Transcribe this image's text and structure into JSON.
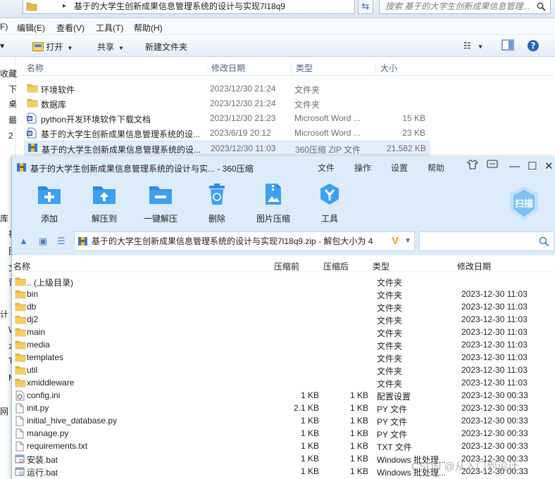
{
  "explorer": {
    "path": "基于的大学生创新成果信息管理系统的设计与实现7l18q9",
    "search_placeholder": "搜索 基于的大学生创新成果信息管理...",
    "menu": [
      "F)",
      "编辑(E)",
      "查看(V)",
      "工具(T)",
      "帮助(H)"
    ],
    "toolbar": {
      "open": "打开",
      "share": "共享",
      "new_folder": "新建文件夹"
    },
    "nav_fragments": [
      "收藏",
      "下",
      "桌",
      "最",
      "2",
      "库",
      "视",
      "图",
      "文",
      "音",
      "计",
      "W",
      "本",
      "T",
      "M",
      "网"
    ],
    "columns": {
      "name": "名称",
      "date": "修改日期",
      "type": "类型",
      "size": "大小"
    },
    "files": [
      {
        "name": "环境软件",
        "date": "2023/12/30 21:24",
        "type": "文件夹",
        "size": "",
        "icon": "folder"
      },
      {
        "name": "数据库",
        "date": "2023/12/30 21:24",
        "type": "文件夹",
        "size": "",
        "icon": "folder"
      },
      {
        "name": "python开发环境软件下载文档",
        "date": "2023/12/30 21:23",
        "type": "Microsoft Word ...",
        "size": "15 KB",
        "icon": "word"
      },
      {
        "name": "基于的大学生创新成果信息管理系统的设...",
        "date": "2023/6/19 20:12",
        "type": "Microsoft Word ...",
        "size": "23 KB",
        "icon": "word"
      },
      {
        "name": "基于的大学生创新成果信息管理系统的设...",
        "date": "2023/12/30 11:03",
        "type": "360压缩 ZIP 文件",
        "size": "21,582 KB",
        "icon": "zip",
        "selected": true
      }
    ]
  },
  "zip": {
    "title": "基于的大学生创新成果信息管理系统的设计与实... - 360压缩",
    "menu": {
      "file": "文件",
      "ops": "操作",
      "settings": "设置",
      "help": "帮助"
    },
    "tools": {
      "add": "添加",
      "extract": "解压到",
      "one_click": "一键解压",
      "delete": "删除",
      "image": "图片压缩",
      "tools": "工具"
    },
    "scan": "扫描",
    "path": "基于的大学生创新成果信息管理系统的设计与实现7l18q9.zip - 解包大小为 4",
    "columns": {
      "name": "名称",
      "before": "压缩前",
      "after": "压缩后",
      "type": "类型",
      "date": "修改日期"
    },
    "entries": [
      {
        "name": ".. (上级目录)",
        "before": "",
        "after": "",
        "type": "文件夹",
        "date": "",
        "icon": "folder"
      },
      {
        "name": "bin",
        "before": "",
        "after": "",
        "type": "文件夹",
        "date": "2023-12-30 11:03",
        "icon": "folder"
      },
      {
        "name": "db",
        "before": "",
        "after": "",
        "type": "文件夹",
        "date": "2023-12-30 11:03",
        "icon": "folder"
      },
      {
        "name": "dj2",
        "before": "",
        "after": "",
        "type": "文件夹",
        "date": "2023-12-30 11:03",
        "icon": "folder"
      },
      {
        "name": "main",
        "before": "",
        "after": "",
        "type": "文件夹",
        "date": "2023-12-30 11:03",
        "icon": "folder"
      },
      {
        "name": "media",
        "before": "",
        "after": "",
        "type": "文件夹",
        "date": "2023-12-30 11:03",
        "icon": "folder"
      },
      {
        "name": "templates",
        "before": "",
        "after": "",
        "type": "文件夹",
        "date": "2023-12-30 11:03",
        "icon": "folder"
      },
      {
        "name": "util",
        "before": "",
        "after": "",
        "type": "文件夹",
        "date": "2023-12-30 11:03",
        "icon": "folder"
      },
      {
        "name": "xmiddleware",
        "before": "",
        "after": "",
        "type": "文件夹",
        "date": "2023-12-30 11:03",
        "icon": "folder"
      },
      {
        "name": "config.ini",
        "before": "1 KB",
        "after": "1 KB",
        "type": "配置设置",
        "date": "2023-12-30 00:33",
        "icon": "ini"
      },
      {
        "name": "init.py",
        "before": "2.1 KB",
        "after": "1 KB",
        "type": "PY 文件",
        "date": "2023-12-30 00:33",
        "icon": "file"
      },
      {
        "name": "initial_hive_database.py",
        "before": "1 KB",
        "after": "1 KB",
        "type": "PY 文件",
        "date": "2023-12-30 00:33",
        "icon": "file"
      },
      {
        "name": "manage.py",
        "before": "1 KB",
        "after": "1 KB",
        "type": "PY 文件",
        "date": "2023-12-30 00:33",
        "icon": "file"
      },
      {
        "name": "requirements.txt",
        "before": "1 KB",
        "after": "1 KB",
        "type": "TXT 文件",
        "date": "2023-12-30 00:33",
        "icon": "file"
      },
      {
        "name": "安装.bat",
        "before": "1 KB",
        "after": "1 KB",
        "type": "Windows 批处理...",
        "date": "2023-12-30 00:33",
        "icon": "bat"
      },
      {
        "name": "运行.bat",
        "before": "1 KB",
        "after": "1 KB",
        "type": "Windows 批处理...",
        "date": "2023-12-30 00:33",
        "icon": "bat"
      }
    ]
  },
  "watermark": "CSDN @从入门到设计"
}
